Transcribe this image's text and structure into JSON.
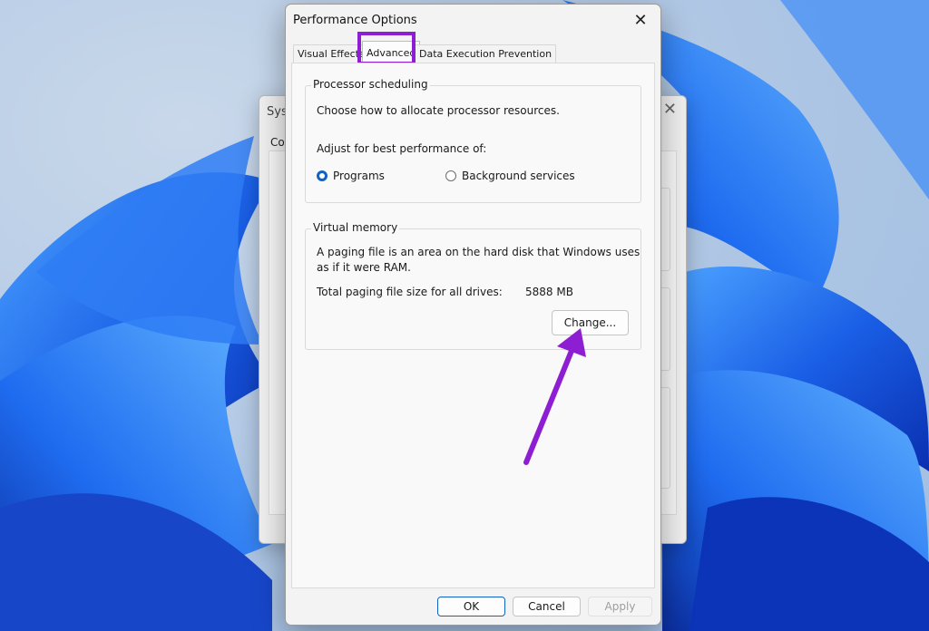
{
  "background_window": {
    "title": "Syst",
    "tab": "Co"
  },
  "dialog": {
    "title": "Performance Options",
    "close_glyph": "✕",
    "tabs": [
      {
        "label": "Visual Effects",
        "active": false
      },
      {
        "label": "Advanced",
        "active": true
      },
      {
        "label": "Data Execution Prevention",
        "active": false
      }
    ]
  },
  "processor_scheduling": {
    "label": "Processor scheduling",
    "description": "Choose how to allocate processor resources.",
    "adjust_label": "Adjust for best performance of:",
    "options": [
      {
        "label": "Programs",
        "checked": true
      },
      {
        "label": "Background services",
        "checked": false
      }
    ]
  },
  "virtual_memory": {
    "label": "Virtual memory",
    "description_line1": "A paging file is an area on the hard disk that Windows uses",
    "description_line2": "as if it were RAM.",
    "total_label": "Total paging file size for all drives:",
    "total_value": "5888 MB",
    "change_button": "Change..."
  },
  "footer": {
    "ok": "OK",
    "cancel": "Cancel",
    "apply": "Apply"
  },
  "colors": {
    "highlight": "#8e1ed2",
    "accent": "#1063c2"
  }
}
